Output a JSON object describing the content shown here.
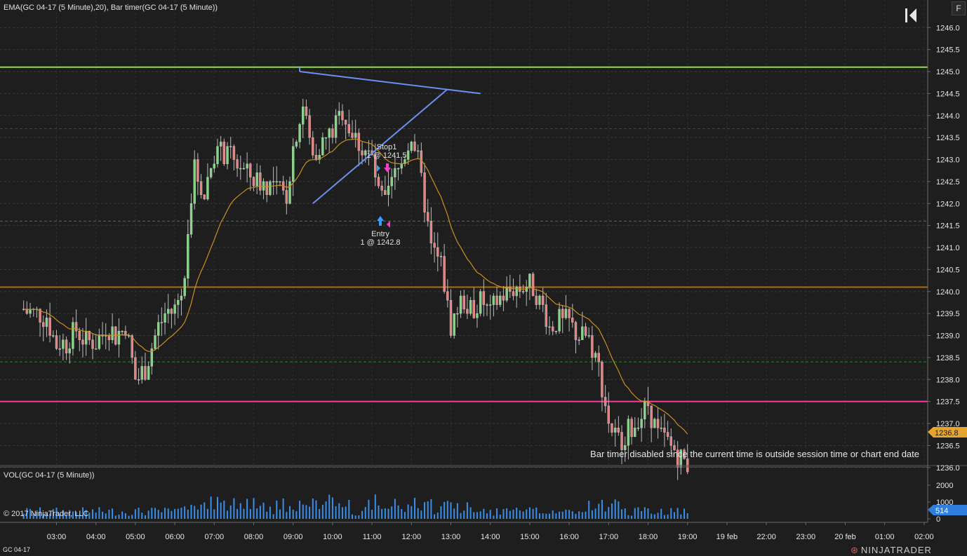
{
  "header": {
    "indicator_label": "EMA(GC 04-17 (5 Minute),20), Bar timer(GC 04-17 (5 Minute))",
    "corner_button": "F"
  },
  "volume_panel": {
    "label": "VOL(GC 04-17 (5 Minute))",
    "current_value": "514"
  },
  "copyright": "© 2017 NinjaTrader, LLC",
  "instrument": "GC 04-17",
  "brand": "NINJATRADER",
  "bar_timer_message": "Bar timer disabled since the current time is outside session time or chart end date",
  "entry_marker": {
    "label": "Entry",
    "detail": "1 @ 1242.8"
  },
  "stop_marker": {
    "label": "Stop1",
    "detail": "1 @ 1241.5"
  },
  "colors": {
    "background": "#1e1e1e",
    "up_candle": "#7fd87f",
    "down_candle": "#e88080",
    "ema": "#c89020",
    "volume": "#3a8ee8",
    "line_green": "#90e040",
    "line_magenta": "#ff3aa0",
    "line_darkred": "#a02020",
    "line_orange": "#b06a10",
    "line_dashgreen": "#2a8a2a",
    "trend_lines": "#6a90f0"
  },
  "chart_data": {
    "type": "candlestick",
    "instrument": "GC 04-17",
    "timeframe": "5 Minute",
    "y_axis": {
      "ylim": [
        1235.9,
        1246.6
      ],
      "tick_labels": [
        "1246.0",
        "1245.5",
        "1245.0",
        "1244.5",
        "1244.0",
        "1243.5",
        "1243.0",
        "1242.5",
        "1242.0",
        "1241.5",
        "1241.0",
        "1240.5",
        "1240.0",
        "1239.5",
        "1239.0",
        "1238.5",
        "1238.0",
        "1237.5",
        "1237.0",
        "1236.5",
        "1236.0"
      ],
      "current_price_label": "1236.8"
    },
    "x_axis": {
      "tick_labels": [
        "03:00",
        "04:00",
        "05:00",
        "06:00",
        "07:00",
        "08:00",
        "09:00",
        "10:00",
        "11:00",
        "12:00",
        "13:00",
        "14:00",
        "15:00",
        "16:00",
        "17:00",
        "18:00",
        "19:00",
        "19 feb",
        "22:00",
        "23:00",
        "20 feb",
        "01:00",
        "02:00"
      ],
      "start_time": "02:10",
      "end_time": "02:20 (next day)"
    },
    "series_close_path": [
      {
        "t": "02:10",
        "p": 1239.6
      },
      {
        "t": "02:45",
        "p": 1239.4
      },
      {
        "t": "03:00",
        "p": 1238.8
      },
      {
        "t": "03:15",
        "p": 1238.8
      },
      {
        "t": "03:30",
        "p": 1239.1
      },
      {
        "t": "03:45",
        "p": 1238.9
      },
      {
        "t": "04:00",
        "p": 1238.8
      },
      {
        "t": "04:15",
        "p": 1239.2
      },
      {
        "t": "04:30",
        "p": 1239.0
      },
      {
        "t": "04:45",
        "p": 1239.2
      },
      {
        "t": "05:00",
        "p": 1238.0
      },
      {
        "t": "05:15",
        "p": 1238.2
      },
      {
        "t": "05:30",
        "p": 1239.0
      },
      {
        "t": "05:45",
        "p": 1239.5
      },
      {
        "t": "06:00",
        "p": 1239.6
      },
      {
        "t": "06:15",
        "p": 1240.2
      },
      {
        "t": "06:20",
        "p": 1241.6
      },
      {
        "t": "06:30",
        "p": 1242.8
      },
      {
        "t": "06:45",
        "p": 1242.2
      },
      {
        "t": "07:00",
        "p": 1243.2
      },
      {
        "t": "07:30",
        "p": 1243.0
      },
      {
        "t": "08:00",
        "p": 1242.5
      },
      {
        "t": "08:30",
        "p": 1242.4
      },
      {
        "t": "08:50",
        "p": 1242.2
      },
      {
        "t": "09:00",
        "p": 1243.3
      },
      {
        "t": "09:15",
        "p": 1244.2
      },
      {
        "t": "09:30",
        "p": 1243.1
      },
      {
        "t": "09:45",
        "p": 1243.4
      },
      {
        "t": "10:00",
        "p": 1243.6
      },
      {
        "t": "10:15",
        "p": 1244.1
      },
      {
        "t": "10:30",
        "p": 1243.6
      },
      {
        "t": "10:45",
        "p": 1243.3
      },
      {
        "t": "11:00",
        "p": 1243.0
      },
      {
        "t": "11:10",
        "p": 1242.2
      },
      {
        "t": "11:20",
        "p": 1242.0
      },
      {
        "t": "11:30",
        "p": 1242.5
      },
      {
        "t": "11:45",
        "p": 1242.9
      },
      {
        "t": "12:00",
        "p": 1243.6
      },
      {
        "t": "12:10",
        "p": 1243.0
      },
      {
        "t": "12:20",
        "p": 1242.0
      },
      {
        "t": "12:30",
        "p": 1241.0
      },
      {
        "t": "12:45",
        "p": 1240.6
      },
      {
        "t": "13:00",
        "p": 1239.2
      },
      {
        "t": "13:15",
        "p": 1239.8
      },
      {
        "t": "13:30",
        "p": 1239.6
      },
      {
        "t": "13:45",
        "p": 1239.8
      },
      {
        "t": "14:00",
        "p": 1239.5
      },
      {
        "t": "14:15",
        "p": 1239.9
      },
      {
        "t": "14:30",
        "p": 1240.0
      },
      {
        "t": "14:45",
        "p": 1240.1
      },
      {
        "t": "15:00",
        "p": 1240.2
      },
      {
        "t": "15:15",
        "p": 1239.8
      },
      {
        "t": "15:30",
        "p": 1239.2
      },
      {
        "t": "15:45",
        "p": 1239.3
      },
      {
        "t": "16:00",
        "p": 1239.3
      },
      {
        "t": "16:15",
        "p": 1239.0
      },
      {
        "t": "16:30",
        "p": 1238.9
      },
      {
        "t": "16:45",
        "p": 1238.3
      },
      {
        "t": "17:00",
        "p": 1237.0
      },
      {
        "t": "17:15",
        "p": 1236.6
      },
      {
        "t": "17:30",
        "p": 1236.8
      },
      {
        "t": "17:45",
        "p": 1237.1
      },
      {
        "t": "18:00",
        "p": 1237.4
      },
      {
        "t": "18:15",
        "p": 1236.8
      },
      {
        "t": "18:30",
        "p": 1236.6
      },
      {
        "t": "18:45",
        "p": 1236.3
      },
      {
        "t": "19:00",
        "p": 1236.0
      }
    ],
    "ema_period": 20,
    "horizontal_lines": [
      {
        "price": 1245.1,
        "color": "#90e040",
        "style": "solid"
      },
      {
        "price": 1243.7,
        "color": "#a02020",
        "style": "dashed"
      },
      {
        "price": 1241.6,
        "color": "#2a8a2a",
        "style": "dashed"
      },
      {
        "price": 1240.1,
        "color": "#b06a10",
        "style": "solid"
      },
      {
        "price": 1238.4,
        "color": "#2a8a2a",
        "style": "dashed"
      },
      {
        "price": 1237.5,
        "color": "#ff3aa0",
        "style": "solid"
      }
    ],
    "triangle": {
      "upper_line": [
        {
          "t": "09:10",
          "p": 1245.0
        },
        {
          "t": "13:45",
          "p": 1244.5
        }
      ],
      "lower_line": [
        {
          "t": "09:30",
          "p": 1242.0
        },
        {
          "t": "12:55",
          "p": 1244.6
        }
      ],
      "apex_tick": [
        {
          "t": "09:10",
          "p": 1245.0
        },
        {
          "t": "09:10",
          "p": 1245.1
        }
      ]
    },
    "volume": {
      "ylim": [
        0,
        2600
      ],
      "tick_labels": [
        "2000",
        "1000",
        "0"
      ],
      "current": 514
    }
  }
}
